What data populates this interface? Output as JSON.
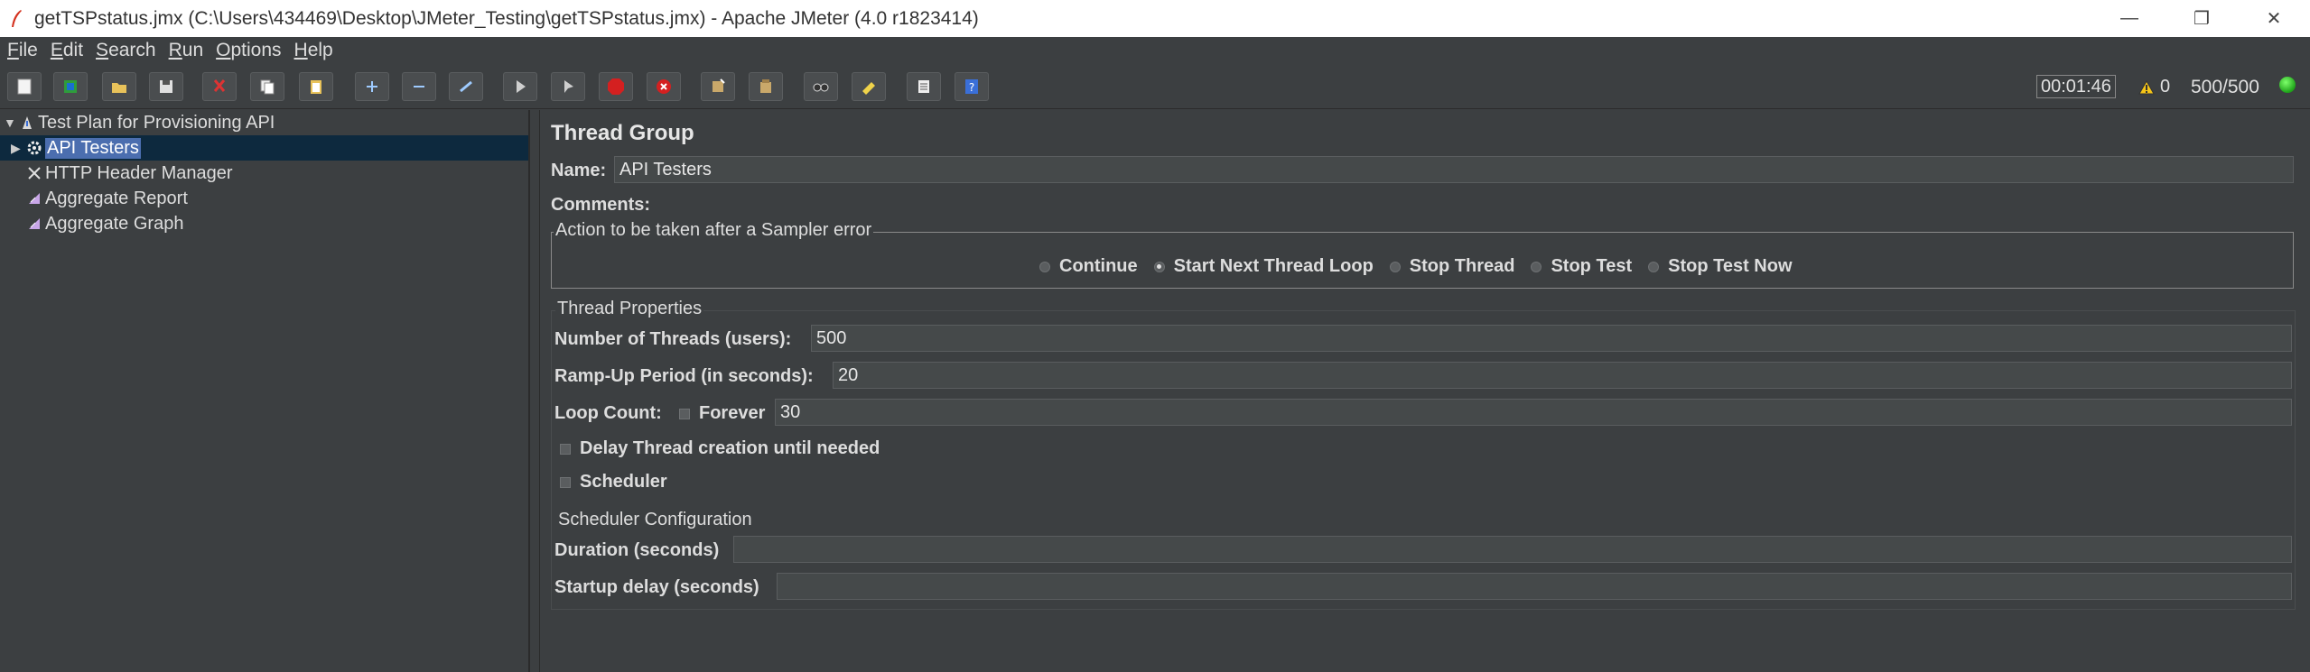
{
  "window": {
    "title": "getTSPstatus.jmx (C:\\Users\\434469\\Desktop\\JMeter_Testing\\getTSPstatus.jmx) - Apache JMeter (4.0 r1823414)",
    "controls": {
      "minimize": "—",
      "restore": "❐",
      "close": "✕"
    }
  },
  "menu": {
    "items": [
      {
        "first": "F",
        "rest": "ile"
      },
      {
        "first": "E",
        "rest": "dit"
      },
      {
        "first": "S",
        "rest": "earch"
      },
      {
        "first": "R",
        "rest": "un"
      },
      {
        "first": "O",
        "rest": "ptions"
      },
      {
        "first": "H",
        "rest": "elp"
      }
    ]
  },
  "toolbar": {
    "buttons": [
      {
        "name": "new-icon"
      },
      {
        "name": "templates-icon"
      },
      {
        "name": "open-icon"
      },
      {
        "name": "save-icon"
      },
      {
        "name": "cut-icon"
      },
      {
        "name": "copy-icon"
      },
      {
        "name": "paste-icon"
      },
      {
        "name": "expand-icon"
      },
      {
        "name": "collapse-icon"
      },
      {
        "name": "toggle-icon"
      },
      {
        "name": "start-icon"
      },
      {
        "name": "start-no-pauses-icon"
      },
      {
        "name": "stop-icon"
      },
      {
        "name": "shutdown-icon"
      },
      {
        "name": "clear-icon"
      },
      {
        "name": "clear-all-icon"
      },
      {
        "name": "search-icon"
      },
      {
        "name": "reset-search-icon"
      },
      {
        "name": "function-helper-icon"
      },
      {
        "name": "help-icon"
      }
    ],
    "elapsed_time": "00:01:46",
    "error_count": "0",
    "active_threads": "500/500"
  },
  "tree": {
    "root": {
      "label": "Test Plan for Provisioning API",
      "icon": "test-plan-icon"
    },
    "items": [
      {
        "label": "API Testers",
        "icon": "thread-group-icon",
        "selected": true
      },
      {
        "label": "HTTP Header Manager",
        "icon": "header-manager-icon"
      },
      {
        "label": "Aggregate Report",
        "icon": "report-icon"
      },
      {
        "label": "Aggregate Graph",
        "icon": "graph-icon"
      }
    ]
  },
  "thread_group": {
    "title": "Thread Group",
    "name_label": "Name:",
    "name_value": "API Testers",
    "comments_label": "Comments:",
    "comments_value": "",
    "sampler_error": {
      "legend": "Action to be taken after a Sampler error",
      "options": [
        "Continue",
        "Start Next Thread Loop",
        "Stop Thread",
        "Stop Test",
        "Stop Test Now"
      ],
      "selected": "Start Next Thread Loop"
    },
    "properties": {
      "legend": "Thread Properties",
      "threads_label": "Number of Threads (users):",
      "threads_value": "500",
      "rampup_label": "Ramp-Up Period (in seconds):",
      "rampup_value": "20",
      "loop_label": "Loop Count:",
      "forever_label": "Forever",
      "forever_checked": false,
      "loop_value": "30",
      "delay_label": "Delay Thread creation until needed",
      "delay_checked": false,
      "scheduler_label": "Scheduler",
      "scheduler_checked": false
    },
    "scheduler": {
      "legend": "Scheduler Configuration",
      "duration_label": "Duration (seconds)",
      "duration_value": "",
      "startup_label": "Startup delay (seconds)",
      "startup_value": ""
    }
  }
}
